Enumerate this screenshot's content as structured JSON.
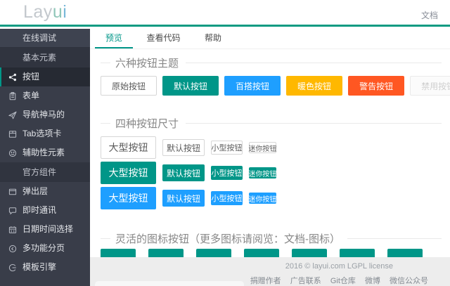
{
  "header": {
    "logo_gray": "Lay",
    "logo_green": "u",
    "logo_blue": "i",
    "doc_link": "文档"
  },
  "sidebar": {
    "debug_label": "在线调试",
    "cat_basic": "基本元素",
    "cat_official": "官方组件",
    "items_basic": [
      {
        "label": "按钮",
        "icon": "share-nodes",
        "selected": true
      },
      {
        "label": "表单",
        "icon": "clipboard",
        "selected": false
      },
      {
        "label": "导航神马的",
        "icon": "paper-plane",
        "selected": false
      },
      {
        "label": "Tab选项卡",
        "icon": "layout-tabs",
        "selected": false
      },
      {
        "label": "辅助性元素",
        "icon": "smiley",
        "selected": false
      }
    ],
    "items_official": [
      {
        "label": "弹出层",
        "icon": "window",
        "selected": false
      },
      {
        "label": "即时通讯",
        "icon": "chat-bubble",
        "selected": false
      },
      {
        "label": "日期时间选择",
        "icon": "calendar",
        "selected": false
      },
      {
        "label": "多功能分页",
        "icon": "circle-arrow-left",
        "selected": false
      },
      {
        "label": "模板引擎",
        "icon": "engine",
        "selected": false
      }
    ]
  },
  "tabs": [
    {
      "label": "预览",
      "active": true
    },
    {
      "label": "查看代码",
      "active": false
    },
    {
      "label": "帮助",
      "active": false
    }
  ],
  "sections": {
    "themes": {
      "title": "六种按钮主题",
      "buttons": [
        {
          "label": "原始按钮",
          "theme": "primitive"
        },
        {
          "label": "默认按钮",
          "theme": "default"
        },
        {
          "label": "百搭按钮",
          "theme": "normal"
        },
        {
          "label": "暖色按钮",
          "theme": "warm"
        },
        {
          "label": "警告按钮",
          "theme": "danger"
        },
        {
          "label": "禁用按钮",
          "theme": "disabled"
        }
      ]
    },
    "sizes": {
      "title": "四种按钮尺寸",
      "labels": [
        "大型按钮",
        "默认按钮",
        "小型按钮",
        "迷你按钮"
      ],
      "row_themes": [
        "primitive",
        "default",
        "normal"
      ]
    },
    "icons": {
      "title": "灵活的图标按钮（更多图标请阅览：文档-图标）",
      "button_count": 7
    }
  },
  "footer": {
    "copyright": "2016 © layui.com  LGPL license",
    "links": [
      "捐赠作者",
      "广告联系",
      "Git仓库",
      "微博",
      "微信公众号"
    ]
  },
  "colors": {
    "accent_green": "#009688",
    "normal_blue": "#1E9FFF",
    "warm_yellow": "#FFB800",
    "danger_red": "#FF5722",
    "sidebar_bg": "#393D49",
    "disabled_text": "#CFCFCF",
    "footer_bg": "#EDEDED"
  }
}
